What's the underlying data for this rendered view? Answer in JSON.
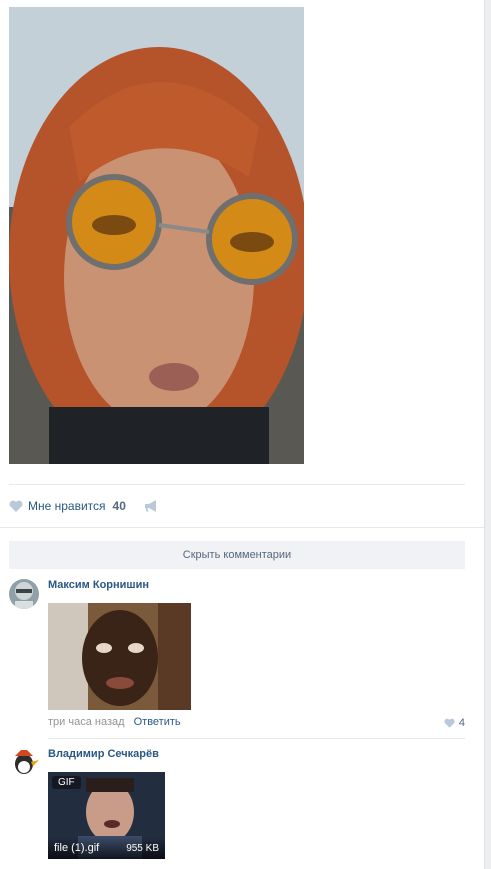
{
  "post": {
    "like_label": "Мне нравится",
    "like_count": "40"
  },
  "comments_bar": {
    "hide_label": "Скрыть комментарии"
  },
  "comments": [
    {
      "author": "Максим Корнишин",
      "time": "три часа назад",
      "reply_label": "Ответить",
      "likes": "4"
    },
    {
      "author": "Владимир Сечкарёв",
      "gif_badge": "GIF",
      "file_name": "file (1).gif",
      "file_size": "955 KB"
    }
  ],
  "colors": {
    "link": "#2a5885",
    "muted": "#939393",
    "icon": "#bac9d9",
    "bar": "#f0f2f5"
  },
  "icons": [
    "heart-icon",
    "megaphone-icon"
  ]
}
